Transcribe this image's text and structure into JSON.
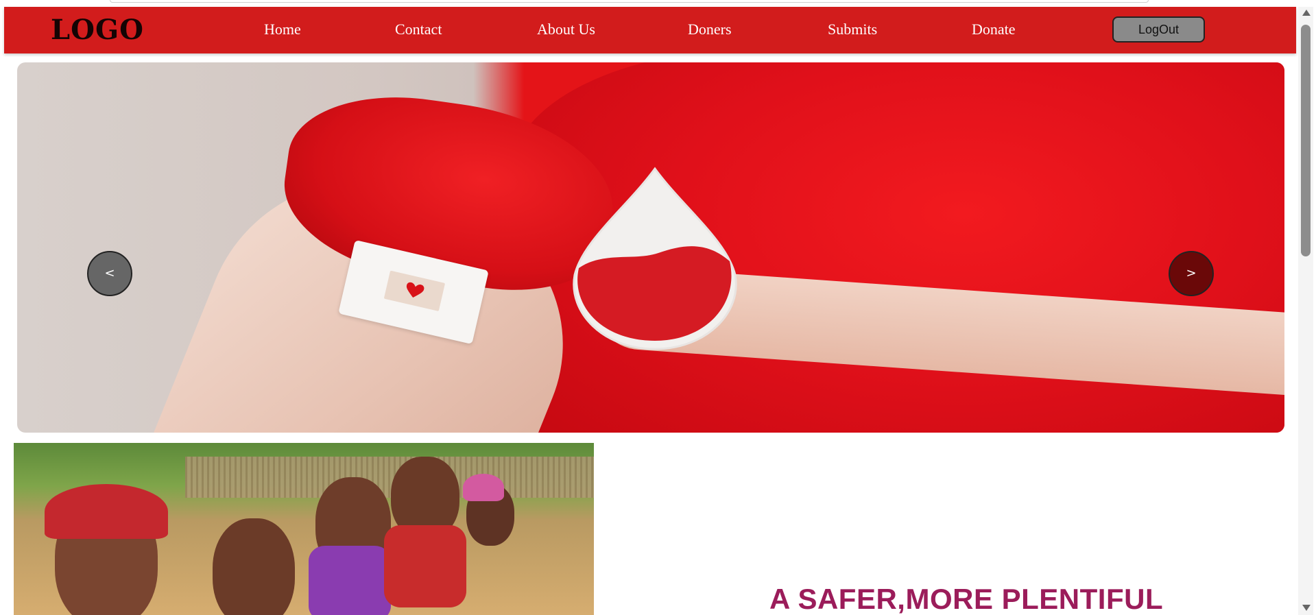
{
  "navbar": {
    "logo": "LOGO",
    "links": [
      "Home",
      "Contact",
      "About Us",
      "Doners",
      "Submits",
      "Donate"
    ],
    "logout_label": "LogOut"
  },
  "slider": {
    "prev_label": "<",
    "next_label": ">"
  },
  "section": {
    "tagline": "A SAFER,MORE PLENTIFUL"
  },
  "colors": {
    "navbar_bg": "#d21c1c",
    "tagline": "#9b1c5a",
    "logout_bg": "#8a8a8a"
  }
}
